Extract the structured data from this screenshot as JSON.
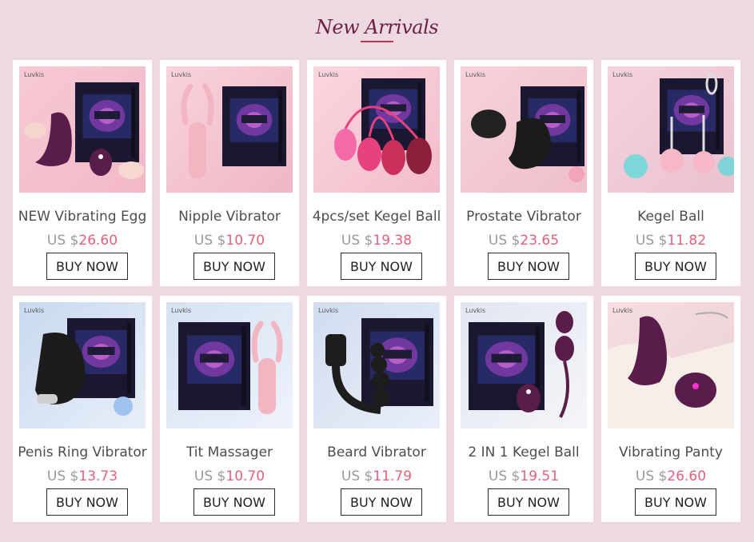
{
  "header": {
    "title": "New Arrivals"
  },
  "currency_prefix": "US $",
  "buy_label": "BUY NOW",
  "brand_logo": "Luvkis",
  "products": [
    {
      "name": "NEW Vibrating Egg",
      "price": "26.60",
      "image": "vibrating-egg-image"
    },
    {
      "name": "Nipple Vibrator",
      "price": "10.70",
      "image": "nipple-vibrator-image"
    },
    {
      "name": "4pcs/set Kegel Ball",
      "price": "19.38",
      "image": "kegel-ball-set-image"
    },
    {
      "name": "Prostate Vibrator",
      "price": "23.65",
      "image": "prostate-vibrator-image"
    },
    {
      "name": "Kegel Ball",
      "price": "11.82",
      "image": "kegel-ball-image"
    },
    {
      "name": "Penis Ring Vibrator",
      "price": "13.73",
      "image": "penis-ring-vibrator-image"
    },
    {
      "name": "Tit Massager",
      "price": "10.70",
      "image": "tit-massager-image"
    },
    {
      "name": "Beard Vibrator",
      "price": "11.79",
      "image": "beard-vibrator-image"
    },
    {
      "name": "2 IN 1 Kegel Ball",
      "price": "19.51",
      "image": "two-in-one-kegel-ball-image"
    },
    {
      "name": "Vibrating Panty",
      "price": "26.60",
      "image": "vibrating-panty-image"
    }
  ],
  "colors": {
    "page_bg": "#ecd9e2",
    "title": "#6e1f45",
    "title_underline": "#d12a4f",
    "price_amount": "#e4607b",
    "product_purple": "#5a1d4b",
    "box_dark": "#1a1830"
  }
}
